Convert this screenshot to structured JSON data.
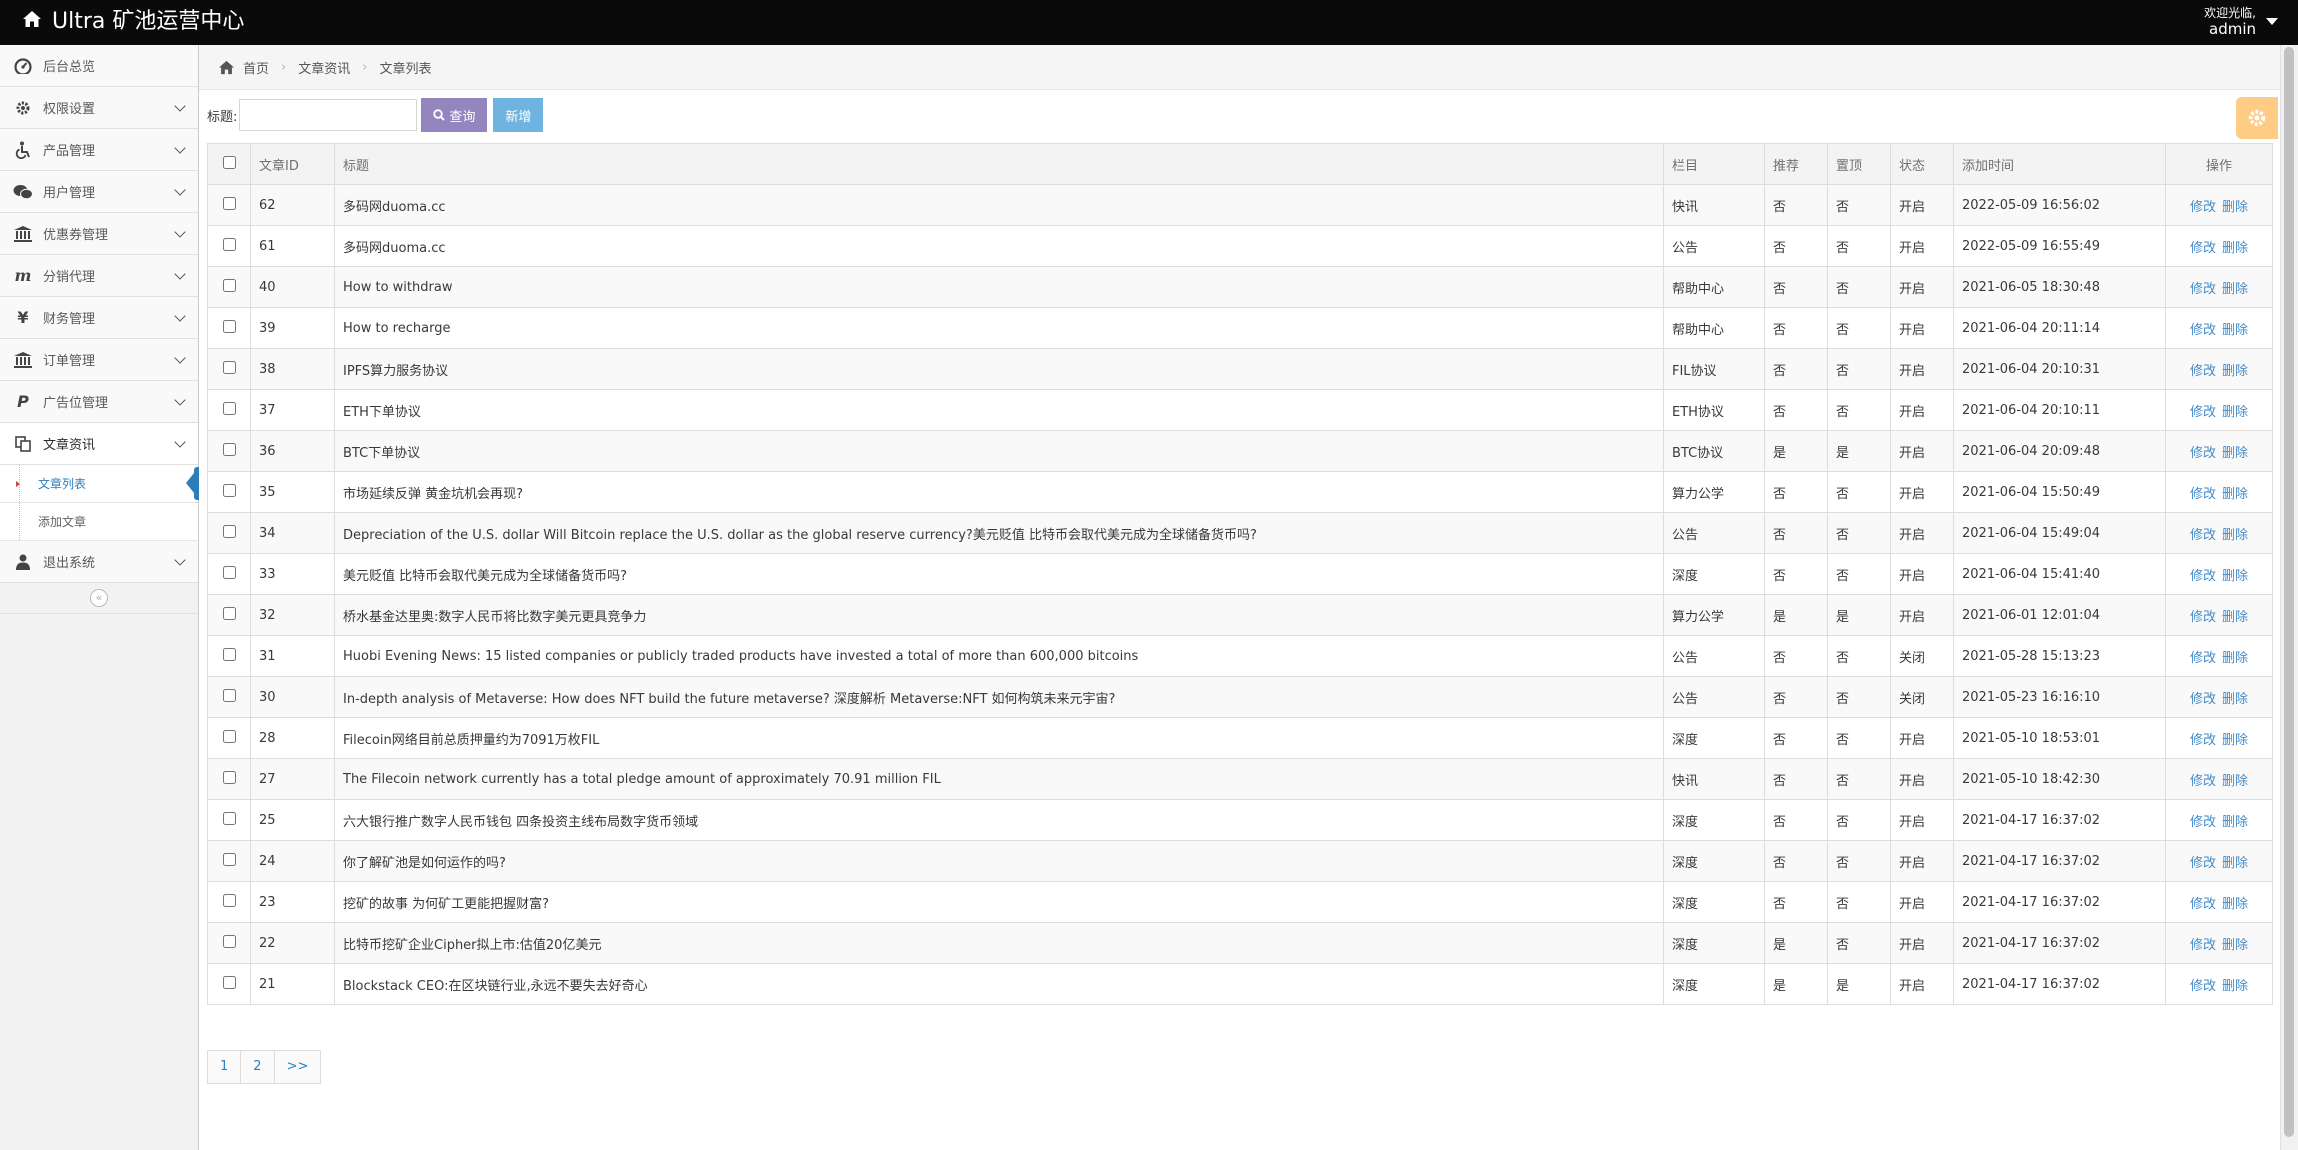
{
  "app": {
    "title": "Ultra 矿池运营中心"
  },
  "user": {
    "welcome": "欢迎光临,",
    "name": "admin"
  },
  "sidebar": {
    "items": [
      {
        "label": "后台总览",
        "icon": "dashboard-icon"
      },
      {
        "label": "权限设置",
        "icon": "gear-icon"
      },
      {
        "label": "产品管理",
        "icon": "wheelchair-icon"
      },
      {
        "label": "用户管理",
        "icon": "wechat-icon"
      },
      {
        "label": "优惠券管理",
        "icon": "bank-icon"
      },
      {
        "label": "分销代理",
        "icon": "m-icon"
      },
      {
        "label": "财务管理",
        "icon": "yen-icon"
      },
      {
        "label": "订单管理",
        "icon": "bank-icon"
      },
      {
        "label": "广告位管理",
        "icon": "paypal-icon"
      },
      {
        "label": "文章资讯",
        "icon": "copy-icon"
      },
      {
        "label": "退出系统",
        "icon": "user-icon"
      }
    ],
    "submenu": [
      {
        "label": "文章列表"
      },
      {
        "label": "添加文章"
      }
    ],
    "collapse": "«"
  },
  "breadcrumb": {
    "home": "首页",
    "section": "文章资讯",
    "page": "文章列表"
  },
  "toolbar": {
    "title_label": "标题:",
    "search_value": "",
    "search_label": "查询",
    "add_label": "新增"
  },
  "table": {
    "headers": [
      "文章ID",
      "标题",
      "栏目",
      "推荐",
      "置顶",
      "状态",
      "添加时间",
      "操作"
    ],
    "edit_label": "修改",
    "delete_label": "删除",
    "rows": [
      [
        "62",
        "多码网duoma.cc",
        "快讯",
        "否",
        "否",
        "开启",
        "2022-05-09 16:56:02"
      ],
      [
        "61",
        "多码网duoma.cc",
        "公告",
        "否",
        "否",
        "开启",
        "2022-05-09 16:55:49"
      ],
      [
        "40",
        "How to withdraw",
        "帮助中心",
        "否",
        "否",
        "开启",
        "2021-06-05 18:30:48"
      ],
      [
        "39",
        "How to recharge",
        "帮助中心",
        "否",
        "否",
        "开启",
        "2021-06-04 20:11:14"
      ],
      [
        "38",
        "IPFS算力服务协议",
        "FIL协议",
        "否",
        "否",
        "开启",
        "2021-06-04 20:10:31"
      ],
      [
        "37",
        "ETH下单协议",
        "ETH协议",
        "否",
        "否",
        "开启",
        "2021-06-04 20:10:11"
      ],
      [
        "36",
        "BTC下单协议",
        "BTC协议",
        "是",
        "是",
        "开启",
        "2021-06-04 20:09:48"
      ],
      [
        "35",
        "市场延续反弹 黄金坑机会再现?",
        "算力公学",
        "否",
        "否",
        "开启",
        "2021-06-04 15:50:49"
      ],
      [
        "34",
        "Depreciation of the U.S. dollar Will Bitcoin replace the U.S. dollar as the global reserve currency?美元贬值 比特币会取代美元成为全球储备货币吗?",
        "公告",
        "否",
        "否",
        "开启",
        "2021-06-04 15:49:04"
      ],
      [
        "33",
        "美元贬值 比特币会取代美元成为全球储备货币吗?",
        "深度",
        "否",
        "否",
        "开启",
        "2021-06-04 15:41:40"
      ],
      [
        "32",
        "桥水基金达里奥:数字人民币将比数字美元更具竞争力",
        "算力公学",
        "是",
        "是",
        "开启",
        "2021-06-01 12:01:04"
      ],
      [
        "31",
        "Huobi Evening News: 15 listed companies or publicly traded products have invested a total of more than 600,000 bitcoins",
        "公告",
        "否",
        "否",
        "关闭",
        "2021-05-28 15:13:23"
      ],
      [
        "30",
        "In-depth analysis of Metaverse: How does NFT build the future metaverse? 深度解析 Metaverse:NFT 如何构筑未来元宇宙?",
        "公告",
        "否",
        "否",
        "关闭",
        "2021-05-23 16:16:10"
      ],
      [
        "28",
        "Filecoin网络目前总质押量约为7091万枚FIL",
        "深度",
        "否",
        "否",
        "开启",
        "2021-05-10 18:53:01"
      ],
      [
        "27",
        "The Filecoin network currently has a total pledge amount of approximately 70.91 million FIL",
        "快讯",
        "否",
        "否",
        "开启",
        "2021-05-10 18:42:30"
      ],
      [
        "25",
        "六大银行推广数字人民币钱包 四条投资主线布局数字货币领域",
        "深度",
        "否",
        "否",
        "开启",
        "2021-04-17 16:37:02"
      ],
      [
        "24",
        "你了解矿池是如何运作的吗?",
        "深度",
        "否",
        "否",
        "开启",
        "2021-04-17 16:37:02"
      ],
      [
        "23",
        "挖矿的故事 为何矿工更能把握财富?",
        "深度",
        "否",
        "否",
        "开启",
        "2021-04-17 16:37:02"
      ],
      [
        "22",
        "比特币挖矿企业Cipher拟上市:估值20亿美元",
        "深度",
        "是",
        "否",
        "开启",
        "2021-04-17 16:37:02"
      ],
      [
        "21",
        "Blockstack CEO:在区块链行业,永远不要失去好奇心",
        "深度",
        "是",
        "是",
        "开启",
        "2021-04-17 16:37:02"
      ]
    ]
  },
  "pagination": {
    "pages": [
      "1",
      "2",
      ">>"
    ]
  }
}
